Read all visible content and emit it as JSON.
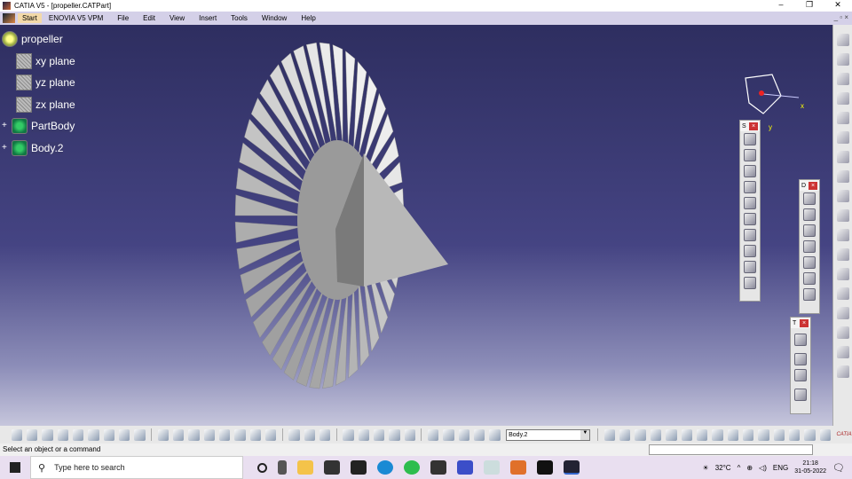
{
  "window": {
    "title": "CATIA V5 - [propeller.CATPart]",
    "controls": [
      "–",
      "❐",
      "✕"
    ],
    "mdi": "_ ▫ ×"
  },
  "menu": {
    "start": "Start",
    "items": [
      "ENOVIA V5 VPM",
      "File",
      "Edit",
      "View",
      "Insert",
      "Tools",
      "Window",
      "Help"
    ]
  },
  "tree": [
    {
      "label": "propeller",
      "icon": "part-icon"
    },
    {
      "label": "xy plane",
      "icon": "plane-icon"
    },
    {
      "label": "yz plane",
      "icon": "plane-icon"
    },
    {
      "label": "zx plane",
      "icon": "plane-icon"
    },
    {
      "label": "PartBody",
      "icon": "body-icon",
      "expand": "+"
    },
    {
      "label": "Body.2",
      "icon": "body-icon",
      "expand": "+"
    }
  ],
  "compass": {
    "x": "x",
    "y": "y"
  },
  "toolbars": {
    "s": "S",
    "d": "D",
    "t": "T",
    "close": "×"
  },
  "bottom_toolbar": {
    "current_body": "Body.2",
    "brand": "CATIA"
  },
  "status": {
    "message": "Select an object or a command"
  },
  "taskbar": {
    "search_placeholder": "Type here to search",
    "temperature": "32°C",
    "language": "ENG",
    "time": "21:18",
    "date": "31-05-2022"
  }
}
